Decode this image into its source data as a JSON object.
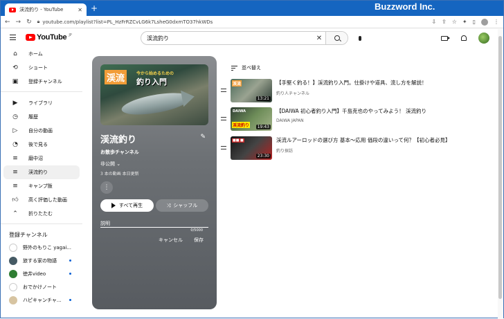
{
  "browser": {
    "tab_title": "渓流釣り - YouTube",
    "url": "youtube.com/playlist?list=PL_HzFrRZCvLG6k7LsheG0dxmTO37hkWDs",
    "brand": "Buzzword Inc."
  },
  "header": {
    "logo_text": "YouTube",
    "logo_sup": "JP",
    "search_value": "渓流釣り"
  },
  "sidebar": {
    "items": [
      {
        "label": "ホーム",
        "icon": "home-icon"
      },
      {
        "label": "ショート",
        "icon": "shorts-icon"
      },
      {
        "label": "登録チャンネル",
        "icon": "subscriptions-icon"
      },
      {
        "label": "ライブラリ",
        "icon": "library-icon"
      },
      {
        "label": "履歴",
        "icon": "history-icon"
      },
      {
        "label": "自分の動画",
        "icon": "your-videos-icon"
      },
      {
        "label": "後で見る",
        "icon": "watch-later-icon"
      },
      {
        "label": "磨中沼",
        "icon": "playlist-icon"
      },
      {
        "label": "渓流釣り",
        "icon": "playlist-icon"
      },
      {
        "label": "キャンプ飯",
        "icon": "playlist-icon"
      },
      {
        "label": "高く評価した動画",
        "icon": "like-icon"
      },
      {
        "label": "折りたたむ",
        "icon": "chevron-up-icon"
      }
    ],
    "subs_heading": "登録チャンネル",
    "subscriptions": [
      {
        "name": "野外のもりこ yagai...",
        "dot": false
      },
      {
        "name": "旅する家の物語",
        "dot": true
      },
      {
        "name": "徳井video",
        "dot": true
      },
      {
        "name": "おでかけノート",
        "dot": false
      },
      {
        "name": "ハピキャンチャ...",
        "dot": true
      }
    ]
  },
  "playlist": {
    "thumb_tag": "渓流",
    "thumb_small": "今から始めるための",
    "thumb_main": "釣り入門",
    "title": "渓流釣り",
    "owner": "お散歩チャンネル",
    "privacy": "非公開",
    "stats": "3 本の動画  本日更新",
    "play_all": "すべて再生",
    "shuffle": "シャッフル",
    "desc_label": "説明",
    "desc_count": "0/5000",
    "cancel": "キャンセル",
    "save": "保存"
  },
  "sort_label": "並べ替え",
  "videos": [
    {
      "title": "【手堅く釣る！】渓流釣り入門。仕掛けや道具、流し方を解説！",
      "channel": "釣り人チャンネル",
      "duration": "13:21"
    },
    {
      "title": "【DAIWA 初心者釣り入門】千島克也のやってみよう！ 渓流釣り",
      "channel": "DAIWA JAPAN",
      "duration": "19:43"
    },
    {
      "title": "渓流ルアーロッドの選び方 基本〜応用 価段の違いって何？【初心者必見】",
      "channel": "釣り探訪",
      "duration": "23:30"
    }
  ]
}
